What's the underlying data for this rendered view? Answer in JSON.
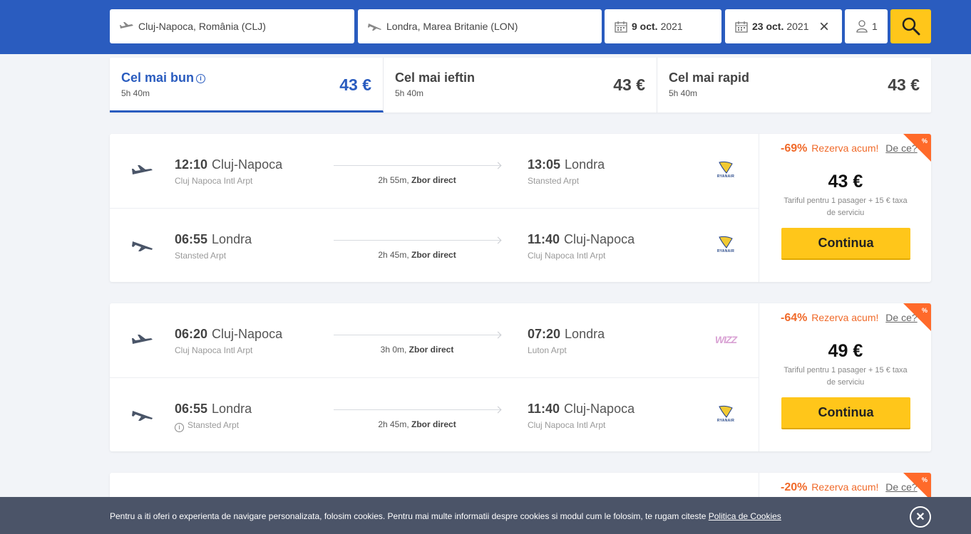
{
  "search": {
    "origin": "Cluj-Napoca, România (CLJ)",
    "destination": "Londra, Marea Britanie (LON)",
    "depart_date_bold": "9 oct.",
    "depart_date_year": "2021",
    "return_date_bold": "23 oct.",
    "return_date_year": "2021",
    "clear_icon": "×",
    "passengers": "1"
  },
  "sort_tabs": [
    {
      "title": "Cel mai bun",
      "duration": "5h 40m",
      "price": "43 €"
    },
    {
      "title": "Cel mai ieftin",
      "duration": "5h 40m",
      "price": "43 €"
    },
    {
      "title": "Cel mai rapid",
      "duration": "5h 40m",
      "price": "43 €"
    }
  ],
  "results": [
    {
      "legs": [
        {
          "dep_time": "12:10",
          "dep_city": "Cluj-Napoca",
          "dep_airport": "Cluj Napoca Intl Arpt",
          "duration": "2h 55m,",
          "type": "Zbor direct",
          "arr_time": "13:05",
          "arr_city": "Londra",
          "arr_airport": "Stansted Arpt",
          "airline": "RYANAIR"
        },
        {
          "dep_time": "06:55",
          "dep_city": "Londra",
          "dep_airport": "Stansted Arpt",
          "duration": "2h 45m,",
          "type": "Zbor direct",
          "arr_time": "11:40",
          "arr_city": "Cluj-Napoca",
          "arr_airport": "Cluj Napoca Intl Arpt",
          "airline": "RYANAIR"
        }
      ],
      "discount": "-69%",
      "reserve": "Rezerva acum!",
      "why": "De ce?",
      "corner": "%",
      "price": "43 €",
      "fare_note": "Tariful pentru 1 pasager + 15 € taxa de serviciu",
      "button": "Continua"
    },
    {
      "legs": [
        {
          "dep_time": "06:20",
          "dep_city": "Cluj-Napoca",
          "dep_airport": "Cluj Napoca Intl Arpt",
          "duration": "3h 0m,",
          "type": "Zbor direct",
          "arr_time": "07:20",
          "arr_city": "Londra",
          "arr_airport": "Luton Arpt",
          "airline": "WIZZ"
        },
        {
          "dep_time": "06:55",
          "dep_city": "Londra",
          "dep_airport": "Stansted Arpt",
          "duration": "2h 45m,",
          "type": "Zbor direct",
          "arr_time": "11:40",
          "arr_city": "Cluj-Napoca",
          "arr_airport": "Cluj Napoca Intl Arpt",
          "airline": "RYANAIR"
        }
      ],
      "discount": "-64%",
      "reserve": "Rezerva acum!",
      "why": "De ce?",
      "corner": "%",
      "price": "49 €",
      "fare_note": "Tariful pentru 1 pasager + 15 € taxa de serviciu",
      "button": "Continua"
    },
    {
      "discount": "-20%",
      "reserve": "Rezerva acum!",
      "why": "De ce?",
      "corner": "%"
    }
  ],
  "cookie": {
    "text": "Pentru a iti oferi o experienta de navigare personalizata, folosim cookies. Pentru mai multe informatii despre cookies si modul cum le folosim, te rugam citeste ",
    "link": "Politica de Cookies",
    "close": "✕"
  }
}
